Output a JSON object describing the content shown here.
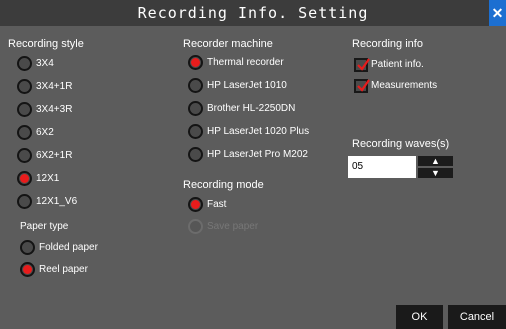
{
  "window": {
    "title": "Recording Info. Setting",
    "close_icon": "✕"
  },
  "recording_style": {
    "heading": "Recording style",
    "options": [
      {
        "label": "3X4",
        "checked": false
      },
      {
        "label": "3X4+1R",
        "checked": false
      },
      {
        "label": "3X4+3R",
        "checked": false
      },
      {
        "label": "6X2",
        "checked": false
      },
      {
        "label": "6X2+1R",
        "checked": false
      },
      {
        "label": "12X1",
        "checked": true
      },
      {
        "label": "12X1_V6",
        "checked": false
      }
    ]
  },
  "paper_type": {
    "heading": "Paper type",
    "options": [
      {
        "label": "Folded paper",
        "checked": false
      },
      {
        "label": "Reel paper",
        "checked": true
      }
    ]
  },
  "recorder_machine": {
    "heading": "Recorder machine",
    "options": [
      {
        "label": "Thermal recorder",
        "checked": true
      },
      {
        "label": "HP LaserJet 1010",
        "checked": false
      },
      {
        "label": "Brother HL-2250DN",
        "checked": false
      },
      {
        "label": "HP LaserJet 1020 Plus",
        "checked": false
      },
      {
        "label": "HP LaserJet Pro M202",
        "checked": false
      }
    ]
  },
  "recording_mode": {
    "heading": "Recording mode",
    "options": [
      {
        "label": "Fast",
        "checked": true,
        "enabled": true
      },
      {
        "label": "Save paper",
        "checked": false,
        "enabled": false
      }
    ]
  },
  "recording_info": {
    "heading": "Recording info",
    "options": [
      {
        "label": "Patient info.",
        "checked": true
      },
      {
        "label": "Measurements",
        "checked": true
      }
    ]
  },
  "recording_waves": {
    "label": "Recording waves(s)",
    "value": "05",
    "up_icon": "▲",
    "down_icon": "▼"
  },
  "buttons": {
    "ok": "OK",
    "cancel": "Cancel"
  },
  "colors": {
    "background": "#5c5c5c",
    "titlebar": "#3c3c3c",
    "selected": "#e81c1c",
    "close": "#1c6fd1"
  }
}
